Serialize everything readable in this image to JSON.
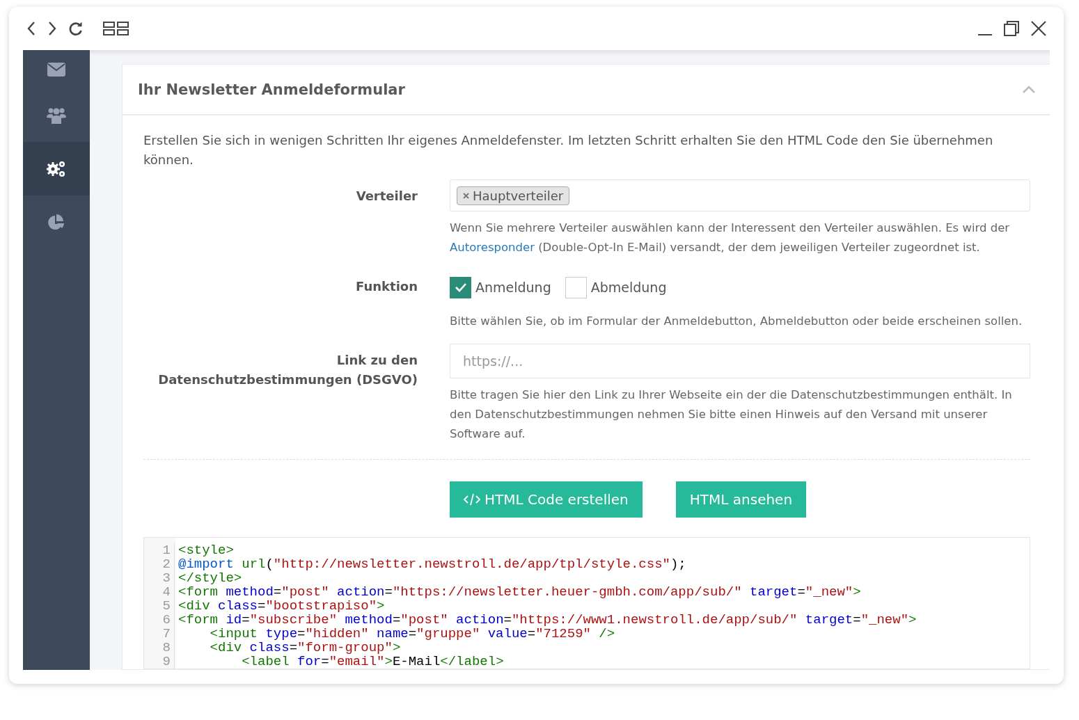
{
  "sidebar": {
    "items": [
      {
        "selected": false
      },
      {
        "selected": false
      },
      {
        "selected": true
      },
      {
        "selected": false
      }
    ]
  },
  "panel": {
    "title": "Ihr Newsletter Anmeldeformular",
    "expanded": true,
    "intro": "Erstellen Sie sich in wenigen Schritten Ihr eigenes Anmeldefenster. Im letzten Schritt erhalten Sie den HTML Code den Sie übernehmen können.",
    "fields": [
      {
        "kind": "tags",
        "label": "Verteiler",
        "tags": [
          "Hauptverteiler"
        ],
        "help": [
          {
            "text": "Wenn Sie mehrere Verteiler auswählen kann der Interessent den Verteiler auswählen. Es wird der "
          },
          {
            "link": "Autoresponder"
          },
          {
            "text": " (Double-Opt-In E-Mail) versandt, der dem jeweiligen Verteiler zugeordnet ist."
          }
        ]
      },
      {
        "kind": "checkboxes",
        "label": "Funktion",
        "options": [
          {
            "label": "Anmeldung",
            "checked": true
          },
          {
            "label": "Abmeldung",
            "checked": false
          }
        ],
        "help": [
          {
            "text": "Bitte wählen Sie, ob im Formular der Anmeldebutton, Abmeldebutton oder beide erscheinen sollen."
          }
        ]
      },
      {
        "kind": "text",
        "label": "Link zu den Datenschutzbestimmungen (DSGVO)",
        "placeholder": "https://...",
        "help": [
          {
            "text": "Bitte tragen Sie hier den Link zu Ihrer Webseite ein der die Datenschutzbestimmungen enthält. In den Datenschutzbestimmungen nehmen Sie bitte einen Hinweis auf den Versand mit unserer Software auf."
          }
        ]
      }
    ],
    "buttons": [
      {
        "kind": "code",
        "label": "HTML Code erstellen"
      },
      {
        "kind": "plain",
        "label": "HTML ansehen"
      }
    ],
    "code": [
      {
        "number": "1",
        "tokens": [
          {
            "kind": "tag",
            "text": "<style>"
          }
        ]
      },
      {
        "number": "2",
        "tokens": [
          {
            "kind": "keyword",
            "text": "@import"
          },
          {
            "kind": "tag",
            "text": " url"
          },
          {
            "kind": "plain",
            "text": "("
          },
          {
            "kind": "string",
            "text": "\"http://newsletter.newstroll.de/app/tpl/style.css\""
          },
          {
            "kind": "plain",
            "text": ");"
          }
        ]
      },
      {
        "number": "3",
        "tokens": [
          {
            "kind": "tag",
            "text": "</style>"
          }
        ]
      },
      {
        "number": "4",
        "tokens": [
          {
            "kind": "tag",
            "text": "<form"
          },
          {
            "kind": "attr",
            "text": " method"
          },
          {
            "kind": "plain",
            "text": "="
          },
          {
            "kind": "string",
            "text": "\"post\""
          },
          {
            "kind": "attr",
            "text": " action"
          },
          {
            "kind": "plain",
            "text": "="
          },
          {
            "kind": "string",
            "text": "\"https://newsletter.heuer-gmbh.com/app/sub/\""
          },
          {
            "kind": "attr",
            "text": " target"
          },
          {
            "kind": "plain",
            "text": "="
          },
          {
            "kind": "string",
            "text": "\"_new\""
          },
          {
            "kind": "tag",
            "text": ">"
          }
        ]
      },
      {
        "number": "5",
        "tokens": [
          {
            "kind": "tag",
            "text": "<div"
          },
          {
            "kind": "attr",
            "text": " class"
          },
          {
            "kind": "plain",
            "text": "="
          },
          {
            "kind": "string",
            "text": "\"bootstrapiso\""
          },
          {
            "kind": "tag",
            "text": ">"
          }
        ]
      },
      {
        "number": "6",
        "tokens": [
          {
            "kind": "tag",
            "text": "<form"
          },
          {
            "kind": "attr",
            "text": " id"
          },
          {
            "kind": "plain",
            "text": "="
          },
          {
            "kind": "string",
            "text": "\"subscribe\""
          },
          {
            "kind": "attr",
            "text": " method"
          },
          {
            "kind": "plain",
            "text": "="
          },
          {
            "kind": "string",
            "text": "\"post\""
          },
          {
            "kind": "attr",
            "text": " action"
          },
          {
            "kind": "plain",
            "text": "="
          },
          {
            "kind": "string",
            "text": "\"https://www1.newstroll.de/app/sub/\""
          },
          {
            "kind": "attr",
            "text": " target"
          },
          {
            "kind": "plain",
            "text": "="
          },
          {
            "kind": "string",
            "text": "\"_new\""
          },
          {
            "kind": "tag",
            "text": ">"
          }
        ]
      },
      {
        "number": "7",
        "tokens": [
          {
            "kind": "tag",
            "text": "    <input"
          },
          {
            "kind": "attr",
            "text": " type"
          },
          {
            "kind": "plain",
            "text": "="
          },
          {
            "kind": "string",
            "text": "\"hidden\""
          },
          {
            "kind": "attr",
            "text": " name"
          },
          {
            "kind": "plain",
            "text": "="
          },
          {
            "kind": "string",
            "text": "\"gruppe\""
          },
          {
            "kind": "attr",
            "text": " value"
          },
          {
            "kind": "plain",
            "text": "="
          },
          {
            "kind": "string",
            "text": "\"71259\""
          },
          {
            "kind": "tag",
            "text": " />"
          }
        ]
      },
      {
        "number": "8",
        "tokens": [
          {
            "kind": "tag",
            "text": "    <div"
          },
          {
            "kind": "attr",
            "text": " class"
          },
          {
            "kind": "plain",
            "text": "="
          },
          {
            "kind": "string",
            "text": "\"form-group\""
          },
          {
            "kind": "tag",
            "text": ">"
          }
        ]
      },
      {
        "number": "9",
        "tokens": [
          {
            "kind": "tag",
            "text": "        <label"
          },
          {
            "kind": "attr",
            "text": " for"
          },
          {
            "kind": "plain",
            "text": "="
          },
          {
            "kind": "string",
            "text": "\"email\""
          },
          {
            "kind": "tag",
            "text": ">"
          },
          {
            "kind": "plain",
            "text": "E-Mail"
          },
          {
            "kind": "tag",
            "text": "</label>"
          }
        ]
      }
    ]
  }
}
